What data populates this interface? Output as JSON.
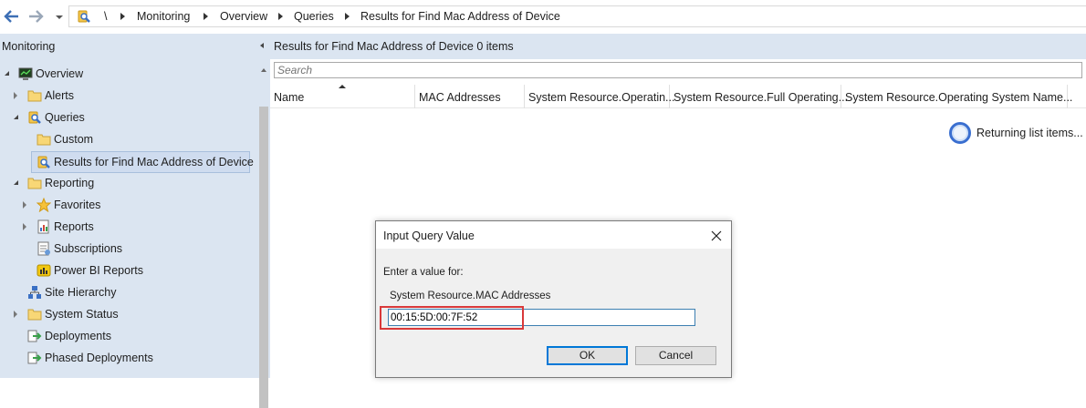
{
  "breadcrumb": {
    "root": "\\",
    "items": [
      "Monitoring",
      "Overview",
      "Queries",
      "Results for Find Mac Address of Device"
    ]
  },
  "nav": {
    "title": "Monitoring",
    "tree": [
      {
        "label": "Overview",
        "icon": "overview-icon",
        "expander": "open"
      },
      {
        "label": "Alerts",
        "icon": "folder-icon",
        "expander": "closed"
      },
      {
        "label": "Queries",
        "icon": "query-icon",
        "expander": "open"
      },
      {
        "label": "Custom",
        "icon": "folder-icon",
        "expander": "none"
      },
      {
        "label": "Results for Find Mac Address of Device",
        "icon": "query-icon",
        "expander": "none",
        "selected": true
      },
      {
        "label": "Reporting",
        "icon": "folder-icon",
        "expander": "open"
      },
      {
        "label": "Favorites",
        "icon": "star-icon",
        "expander": "closed"
      },
      {
        "label": "Reports",
        "icon": "report-icon",
        "expander": "closed"
      },
      {
        "label": "Subscriptions",
        "icon": "subscription-icon",
        "expander": "none"
      },
      {
        "label": "Power BI Reports",
        "icon": "powerbi-icon",
        "expander": "none"
      },
      {
        "label": "Site Hierarchy",
        "icon": "hierarchy-icon",
        "expander": "none"
      },
      {
        "label": "System Status",
        "icon": "folder-icon",
        "expander": "closed"
      },
      {
        "label": "Deployments",
        "icon": "deployment-icon",
        "expander": "none"
      },
      {
        "label": "Phased Deployments",
        "icon": "deployment-icon",
        "expander": "none"
      }
    ]
  },
  "results": {
    "title": "Results for Find Mac Address of Device",
    "count": "0 items",
    "search_placeholder": "Search",
    "columns": [
      "Name",
      "MAC Addresses",
      "System Resource.Operatin...",
      "System Resource.Full Operating...",
      "System Resource.Operating System Name..."
    ],
    "loading_text": "Returning list items..."
  },
  "dialog": {
    "title": "Input Query Value",
    "prompt": "Enter a value for:",
    "field_label": "System Resource.MAC Addresses",
    "value": "00:15:5D:00:7F:52",
    "ok_label": "OK",
    "cancel_label": "Cancel"
  },
  "colors": {
    "nav_background": "#dbe5f1",
    "selection": "#cfdcef",
    "highlight_border": "#d9393a",
    "default_button_border": "#0078d7"
  }
}
